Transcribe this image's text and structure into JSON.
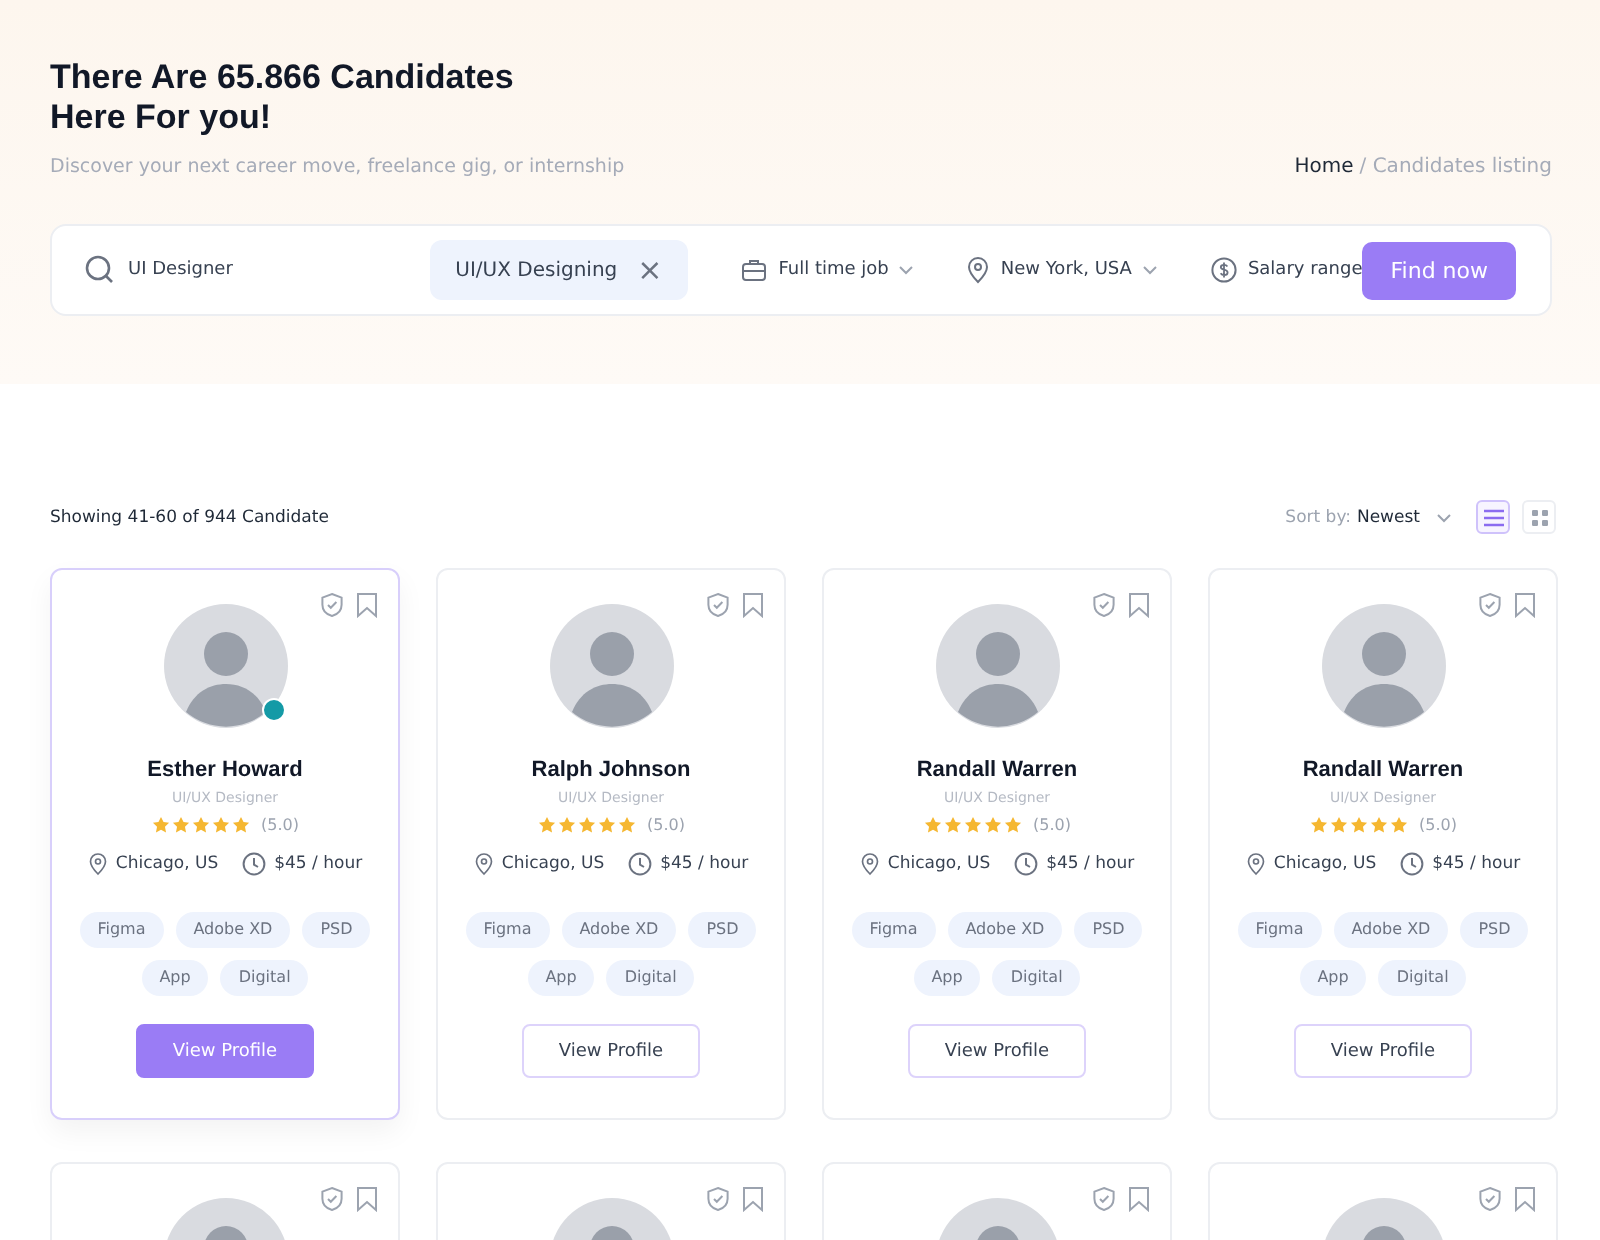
{
  "hero": {
    "title_lines": [
      "There Are 65.866 Candidates",
      "Here For you!"
    ],
    "subtitle": "Discover your next career move, freelance gig, or internship",
    "breadcrumb": {
      "home": "Home",
      "current": "/ Candidates listing"
    }
  },
  "search": {
    "keyword": "UI Designer",
    "chip": "UI/UX Designing",
    "chip_close": "×",
    "filters": [
      {
        "kind": "job",
        "label": "Full time job",
        "dropdown": true
      },
      {
        "kind": "location",
        "label": "New York, USA",
        "dropdown": true
      },
      {
        "kind": "salary",
        "label": "Salary range",
        "dropdown": false
      }
    ],
    "button": "Find now"
  },
  "results": {
    "showing": "Showing 41-60 of 944 Candidate",
    "sort_label": "Sort by:",
    "sort_value": "Newest",
    "views": [
      {
        "kind": "list",
        "selected": true
      },
      {
        "kind": "grid",
        "selected": false
      }
    ]
  },
  "cards": [
    {
      "selected": true,
      "online": true,
      "name": "Esther Howard",
      "role": "UI/UX Designer",
      "stars": 5,
      "rating": "(5.0)",
      "location": "Chicago, US",
      "rate": "$45 / hour",
      "tags": [
        "Figma",
        "Adobe XD",
        "PSD",
        "App",
        "Digital"
      ],
      "button": "View Profile"
    },
    {
      "selected": false,
      "online": false,
      "name": "Ralph Johnson",
      "role": "UI/UX Designer",
      "stars": 5,
      "rating": "(5.0)",
      "location": "Chicago, US",
      "rate": "$45 / hour",
      "tags": [
        "Figma",
        "Adobe XD",
        "PSD",
        "App",
        "Digital"
      ],
      "button": "View Profile"
    },
    {
      "selected": false,
      "online": false,
      "name": "Randall Warren",
      "role": "UI/UX Designer",
      "stars": 5,
      "rating": "(5.0)",
      "location": "Chicago, US",
      "rate": "$45 / hour",
      "tags": [
        "Figma",
        "Adobe XD",
        "PSD",
        "App",
        "Digital"
      ],
      "button": "View Profile"
    },
    {
      "selected": false,
      "online": false,
      "name": "Randall Warren",
      "role": "UI/UX Designer",
      "stars": 5,
      "rating": "(5.0)",
      "location": "Chicago, US",
      "rate": "$45 / hour",
      "tags": [
        "Figma",
        "Adobe XD",
        "PSD",
        "App",
        "Digital"
      ],
      "button": "View Profile"
    },
    {
      "selected": false
    },
    {
      "selected": false
    },
    {
      "selected": false
    },
    {
      "selected": false
    }
  ]
}
